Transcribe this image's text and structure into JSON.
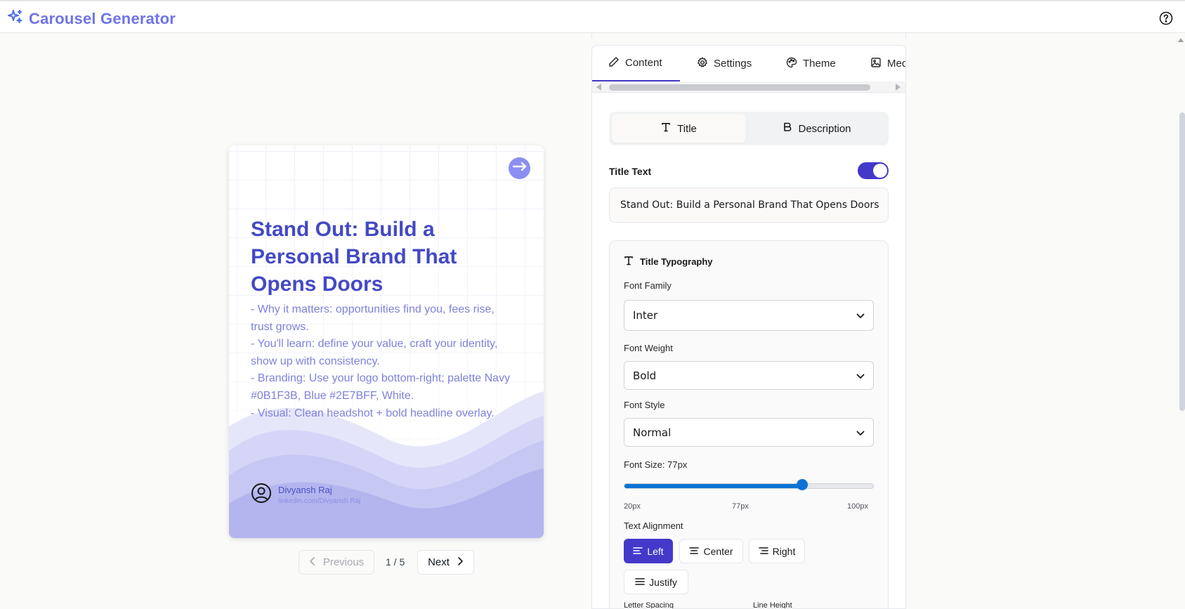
{
  "app": {
    "title": "Carousel Generator",
    "brand_icon": "sparkles-icon",
    "help_icon": "help-circle-icon"
  },
  "slide": {
    "title": "Stand Out: Build a Personal Brand That Opens Doors",
    "description_lines": [
      "- Why it matters: opportunities find you, fees rise,\ntrust grows.",
      "- You'll learn: define your value, craft your identity,\nshow up with consistency.",
      "- Branding: Use your logo bottom-right; palette Navy\n#0B1F3B, Blue #2E7BFF, White.",
      "- Visual: Clean headshot + bold headline overlay."
    ],
    "author_name": "Divyansh Raj",
    "author_link": "linkedin.com/Divyansh Raj",
    "colors": {
      "title": "#4349c4",
      "text": "#7e82db",
      "accent": "#8b8ef0"
    }
  },
  "pager": {
    "prev_label": "Previous",
    "next_label": "Next",
    "indicator": "1 / 5"
  },
  "panel": {
    "tabs": [
      {
        "label": "Content",
        "icon": "pencil-icon",
        "active": true
      },
      {
        "label": "Settings",
        "icon": "gear-icon",
        "active": false
      },
      {
        "label": "Theme",
        "icon": "palette-icon",
        "active": false
      },
      {
        "label": "Med",
        "icon": "image-icon",
        "active": false
      }
    ],
    "segments": [
      {
        "label": "Title",
        "icon": "text-t-icon",
        "active": true
      },
      {
        "label": "Description",
        "icon": "bold-b-icon",
        "active": false
      }
    ],
    "title_text_label": "Title Text",
    "title_text_enabled": true,
    "title_text_value": "Stand Out: Build a Personal Brand That Opens Doors",
    "typography": {
      "heading": "Title Typography",
      "font_family_label": "Font Family",
      "font_family_value": "Inter",
      "font_weight_label": "Font Weight",
      "font_weight_value": "Bold",
      "font_style_label": "Font Style",
      "font_style_value": "Normal",
      "font_size_label": "Font Size: 77px",
      "font_size_min": "20px",
      "font_size_current": "77px",
      "font_size_max": "100px",
      "font_size_value": 77,
      "font_size_range": [
        20,
        100
      ],
      "alignment_label": "Text Alignment",
      "alignments": [
        {
          "label": "Left",
          "active": true
        },
        {
          "label": "Center",
          "active": false
        },
        {
          "label": "Right",
          "active": false
        },
        {
          "label": "Justify",
          "active": false
        }
      ],
      "letter_spacing_label": "Letter Spacing",
      "line_height_label": "Line Height"
    },
    "accent_color": "#4338ca"
  }
}
